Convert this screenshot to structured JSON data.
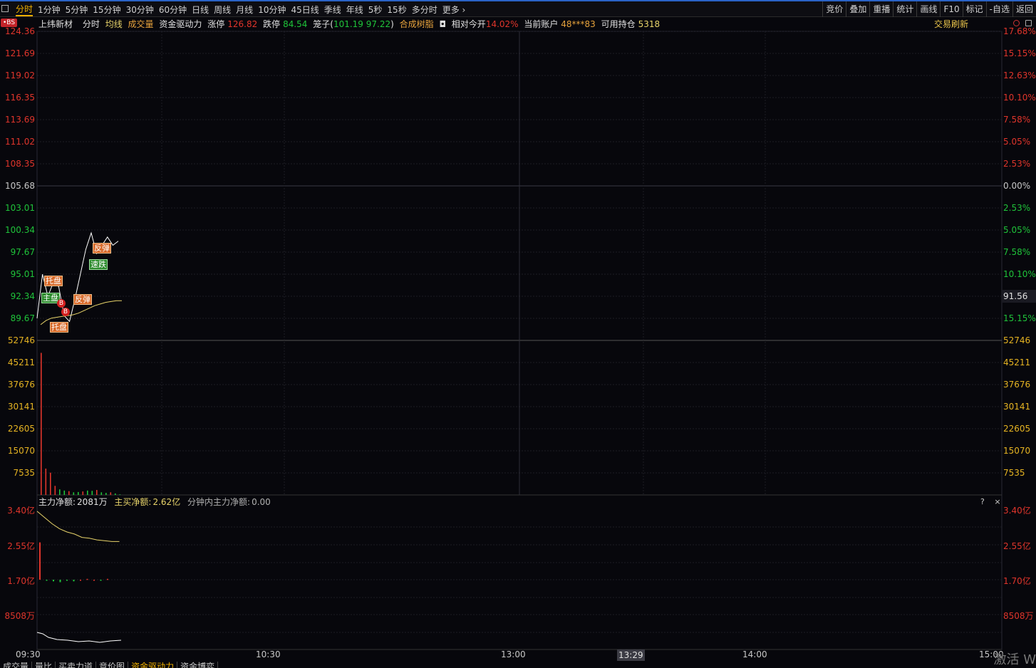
{
  "toolbar": {
    "tabs": [
      "分时",
      "1分钟",
      "5分钟",
      "15分钟",
      "30分钟",
      "60分钟",
      "日线",
      "周线",
      "月线",
      "10分钟",
      "45日线",
      "季线",
      "年线",
      "5秒",
      "15秒",
      "多分时",
      "更多 ›"
    ],
    "right_tools": [
      "竞价",
      "叠加",
      "重播",
      "统计",
      "画线",
      "F10",
      "标记",
      "-自选",
      "返回"
    ]
  },
  "info": {
    "bs_badge": "•BS",
    "stock_name": "上纬新材",
    "mode": "分时",
    "avg_line": "均线",
    "volume": "成交量",
    "fund_drive": "资金驱动力",
    "limit_up_label": "涨停",
    "limit_up_value": "126.82",
    "limit_down_label": "跌停",
    "limit_down_value": "84.54",
    "cage_label": "笼子(",
    "cage_value": "101.19 97.22",
    "cage_close": ")",
    "concept": "合成树脂",
    "open_rel_label": "相对今开",
    "open_rel_value": "14.02%",
    "account_label": "当前账户",
    "account_value": "48***83",
    "position_label": "可用持仓",
    "position_value": "5318",
    "trade_refresh": "交易刷新"
  },
  "price_axis": [
    "124.36",
    "121.69",
    "119.02",
    "116.35",
    "113.69",
    "111.02",
    "108.35",
    "105.68",
    "103.01",
    "100.34",
    "97.67",
    "95.01",
    "92.34",
    "89.67"
  ],
  "pct_axis": [
    "17.68%",
    "15.15%",
    "12.63%",
    "10.10%",
    "7.58%",
    "5.05%",
    "2.53%",
    "0.00%",
    "2.53%",
    "5.05%",
    "7.58%",
    "10.10%",
    "12.63%",
    "15.15%"
  ],
  "vol_axis": [
    "52746",
    "45211",
    "37676",
    "30141",
    "22605",
    "15070",
    "7535"
  ],
  "current_price_label": "91.56",
  "indicator": {
    "main_net_label": "主力净额:",
    "main_net_value": "2081万",
    "main_buy_label": "主买净额:",
    "main_buy_value": "2.62亿",
    "minute_label": "分钟内主力净额:",
    "minute_value": "0.00",
    "help": "?",
    "close": "×"
  },
  "ind_axis": [
    "3.40亿",
    "2.55亿",
    "1.70亿",
    "8508万"
  ],
  "time_axis": [
    "09:30",
    "10:30",
    "13:00",
    "14:00",
    "15:00"
  ],
  "crosshair_time": "13:29",
  "signals": [
    "托盘",
    "主盘",
    "反弹",
    "反弹",
    "速跌",
    "托盘"
  ],
  "bmarks": [
    "B",
    "B"
  ],
  "bottom_tabs": [
    "成交量",
    "量比",
    "买卖力道",
    "竞价图",
    "资金驱动力",
    "资金博弈"
  ],
  "watermark": "激活 W",
  "colors": {
    "up": "#e0352b",
    "down": "#1fc43a",
    "avg": "#e8d46a",
    "price": "#ffffff",
    "grid": "#1c1c24",
    "accent": "#f0b000"
  },
  "chart_data": {
    "type": "line",
    "price_series": [
      {
        "name": "分时",
        "values": [
          89.67,
          95.0,
          92.34,
          94.0,
          93.5,
          90.0,
          89.3,
          92.0,
          95.0,
          98.0,
          100.0,
          97.5,
          98.5,
          99.5,
          98.5,
          99.0
        ]
      }
    ],
    "avg_series": [
      {
        "name": "均线",
        "values": [
          88.9,
          89.4,
          89.7,
          89.8,
          89.9,
          90.0,
          90.1,
          90.3,
          90.6,
          90.9,
          91.2,
          91.4,
          91.6,
          91.7,
          91.8,
          91.8
        ]
      }
    ],
    "volume": [
      48500,
      9000,
      7600,
      3100,
      1900,
      1500,
      1300,
      900,
      1000,
      1200,
      1500,
      1400,
      1700,
      900,
      700,
      900,
      500,
      200
    ],
    "ind_line": [
      3.35,
      3.2,
      3.05,
      2.93,
      2.85,
      2.8,
      2.72,
      2.7,
      2.66,
      2.64,
      2.62,
      2.62
    ],
    "ind_bars": [
      2.6,
      1.68,
      1.66,
      1.64,
      1.68,
      1.66,
      1.7,
      1.72,
      1.7,
      1.68,
      1.72
    ],
    "ylim_price": [
      89.67,
      124.36
    ],
    "ylim_volume": [
      0,
      52746
    ]
  }
}
